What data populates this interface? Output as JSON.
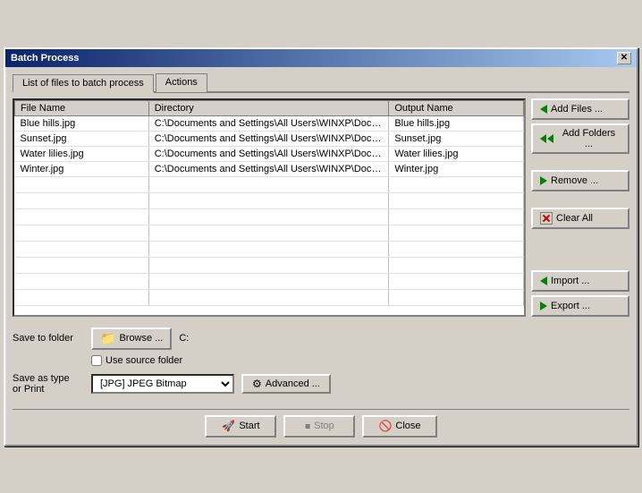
{
  "window": {
    "title": "Batch Process",
    "close_button": "✕"
  },
  "tabs": [
    {
      "label": "List of files to batch process",
      "active": true
    },
    {
      "label": "Actions",
      "active": false
    }
  ],
  "table": {
    "headers": [
      "File Name",
      "Directory",
      "Output Name"
    ],
    "rows": [
      {
        "filename": "Blue hills.jpg",
        "directory": "C:\\Documents and Settings\\All Users\\WINXP\\Documents...",
        "output": "Blue hills.jpg"
      },
      {
        "filename": "Sunset.jpg",
        "directory": "C:\\Documents and Settings\\All Users\\WINXP\\Documents...",
        "output": "Sunset.jpg"
      },
      {
        "filename": "Water lilies.jpg",
        "directory": "C:\\Documents and Settings\\All Users\\WINXP\\Documents...",
        "output": "Water lilies.jpg"
      },
      {
        "filename": "Winter.jpg",
        "directory": "C:\\Documents and Settings\\All Users\\WINXP\\Documents...",
        "output": "Winter.jpg"
      }
    ]
  },
  "buttons": {
    "add_files": "Add Files ...",
    "add_folders": "Add Folders ...",
    "remove": "Remove ...",
    "clear_all": "Clear All",
    "import": "Import ...",
    "export": "Export ..."
  },
  "save_section": {
    "save_to_folder_label": "Save to folder",
    "browse_label": "Browse ...",
    "path": "C:",
    "use_source_label": "Use source folder",
    "save_as_label": "Save as type\nor Print",
    "save_type": "[JPG] JPEG Bitmap",
    "advanced_label": "Advanced ..."
  },
  "bottom_buttons": {
    "start": "Start",
    "stop": "Stop",
    "close": "Close"
  }
}
